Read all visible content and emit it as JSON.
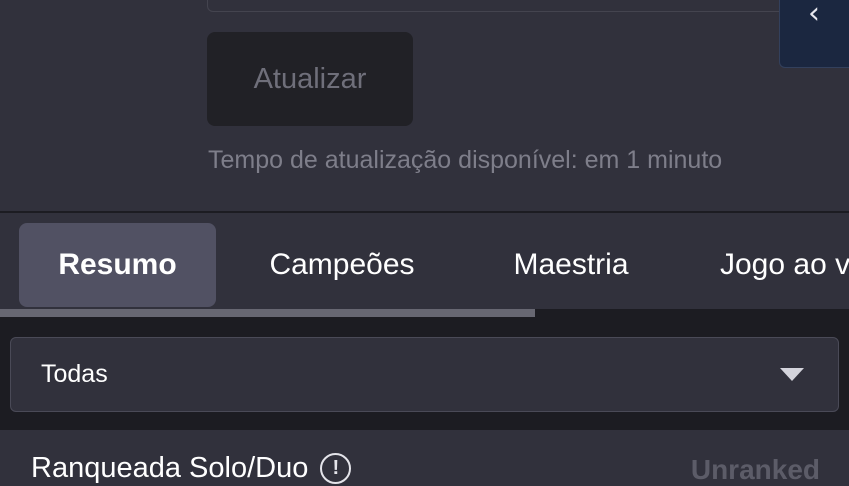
{
  "header": {
    "collapse_icon": "chevron-left-icon",
    "collapse_glyph": "‹",
    "update_button_label": "Atualizar",
    "update_hint": "Tempo de atualização disponível: em 1 minuto"
  },
  "tabs": [
    {
      "label": "Resumo",
      "active": true
    },
    {
      "label": "Campeões",
      "active": false
    },
    {
      "label": "Maestria",
      "active": false
    },
    {
      "label": "Jogo ao vivo",
      "active": false
    }
  ],
  "filter": {
    "selected": "Todas",
    "arrow_icon": "caret-down-icon"
  },
  "ranked": {
    "title": "Ranqueada Solo/Duo",
    "info_icon": "info-icon",
    "info_glyph": "!",
    "value": "Unranked"
  },
  "colors": {
    "panel": "#31313c",
    "background": "#1c1c22",
    "active_tab": "#515163",
    "collapse_button": "#1b2740",
    "muted_text": "#7e7e8a"
  }
}
